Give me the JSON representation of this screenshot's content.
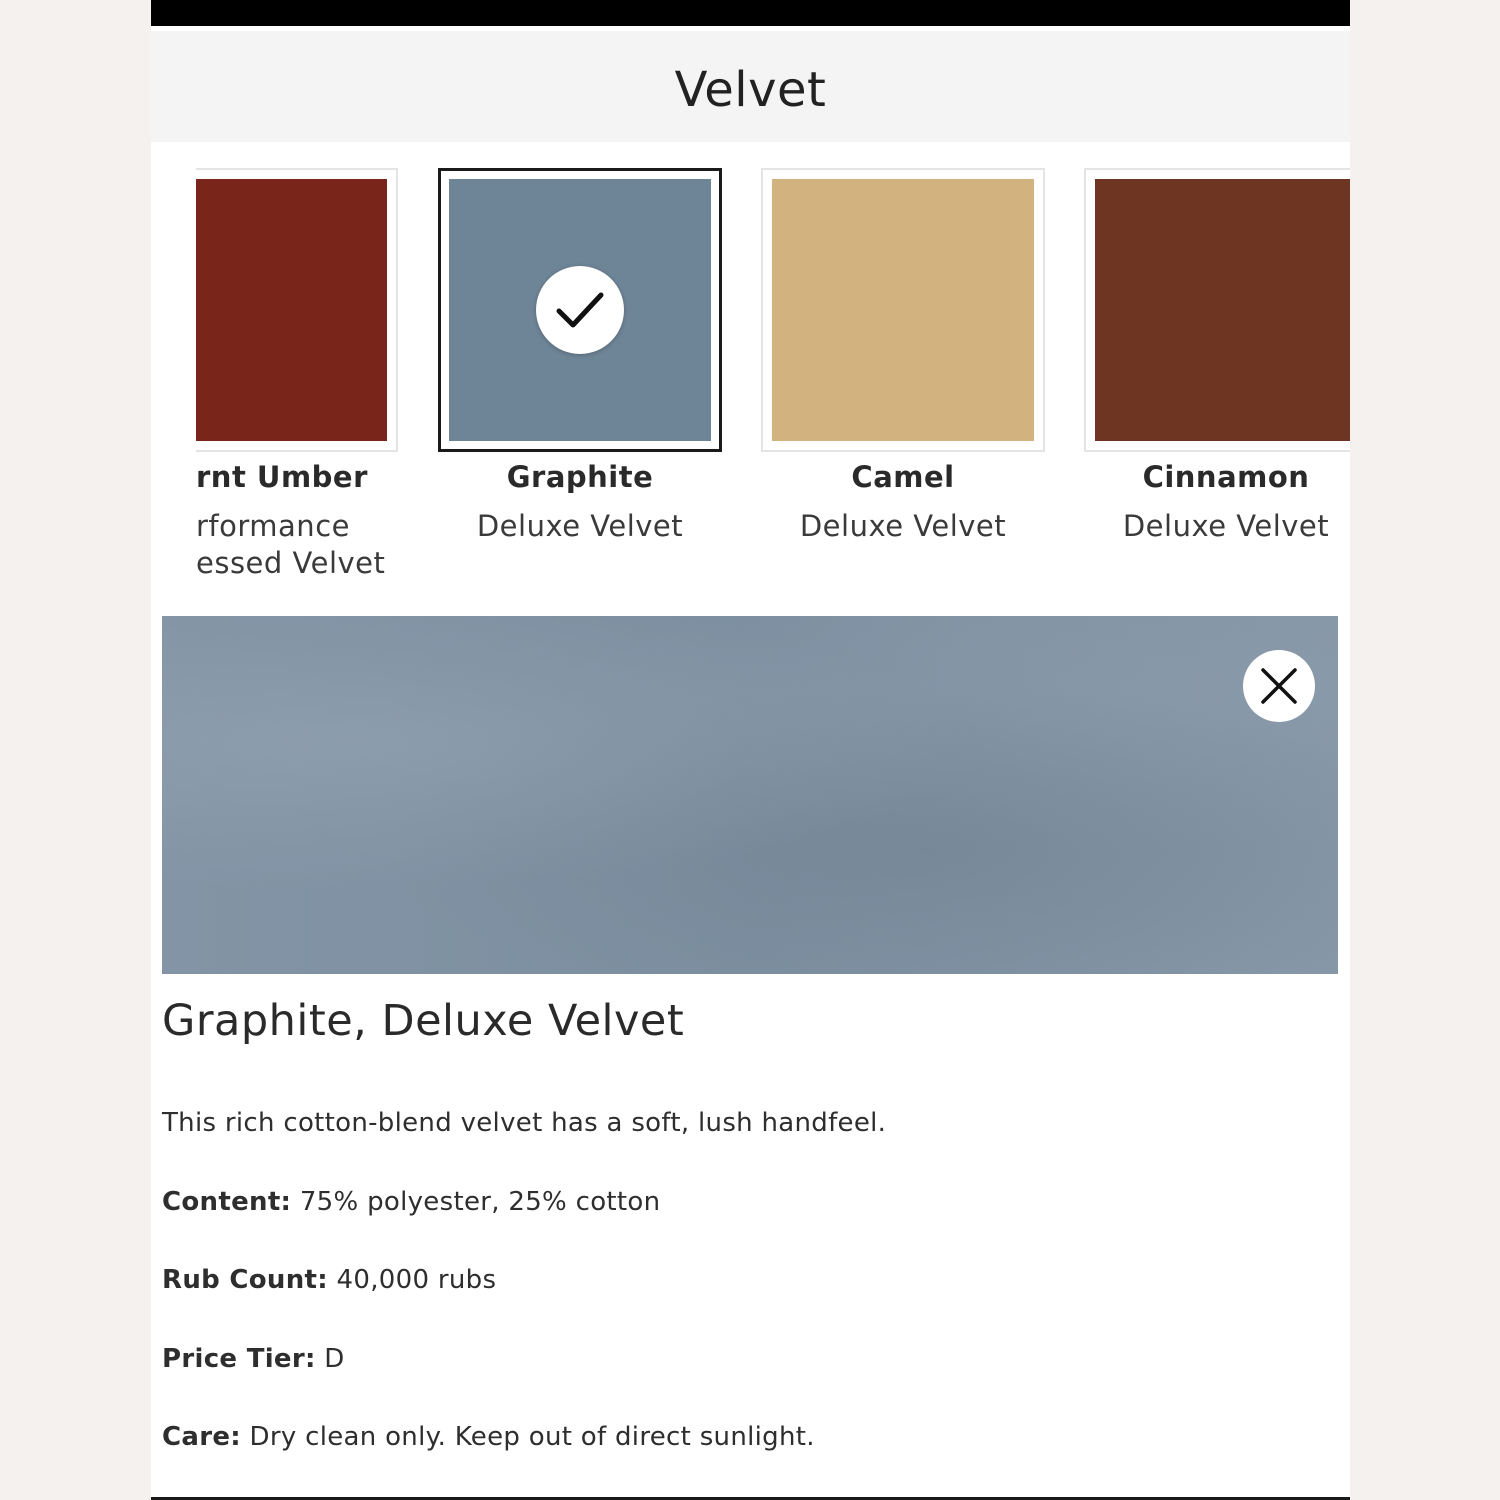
{
  "header": {
    "title": "Velvet"
  },
  "swatches": [
    {
      "name": "rnt Umber",
      "type": "rformance\nessed Velvet",
      "color": "#7a2519",
      "selected": false
    },
    {
      "name": "Graphite",
      "type": "Deluxe Velvet",
      "color": "#6e8597",
      "selected": true
    },
    {
      "name": "Camel",
      "type": "Deluxe Velvet",
      "color": "#d2b27f",
      "selected": false
    },
    {
      "name": "Cinnamon",
      "type": "Deluxe Velvet",
      "color": "#6d3522",
      "selected": false
    }
  ],
  "icons": {
    "selected_check": "checkmark-icon",
    "close": "close-icon"
  },
  "detail": {
    "title": "Graphite, Deluxe Velvet",
    "description": "This rich cotton-blend velvet has a soft, lush handfeel.",
    "content_label": "Content:",
    "content_value": " 75% polyester, 25% cotton",
    "rub_label": "Rub Count:",
    "rub_value": " 40,000 rubs",
    "price_label": "Price Tier:",
    "price_value": " D",
    "care_label": "Care:",
    "care_value": " Dry clean only. Keep out of direct sunlight."
  }
}
